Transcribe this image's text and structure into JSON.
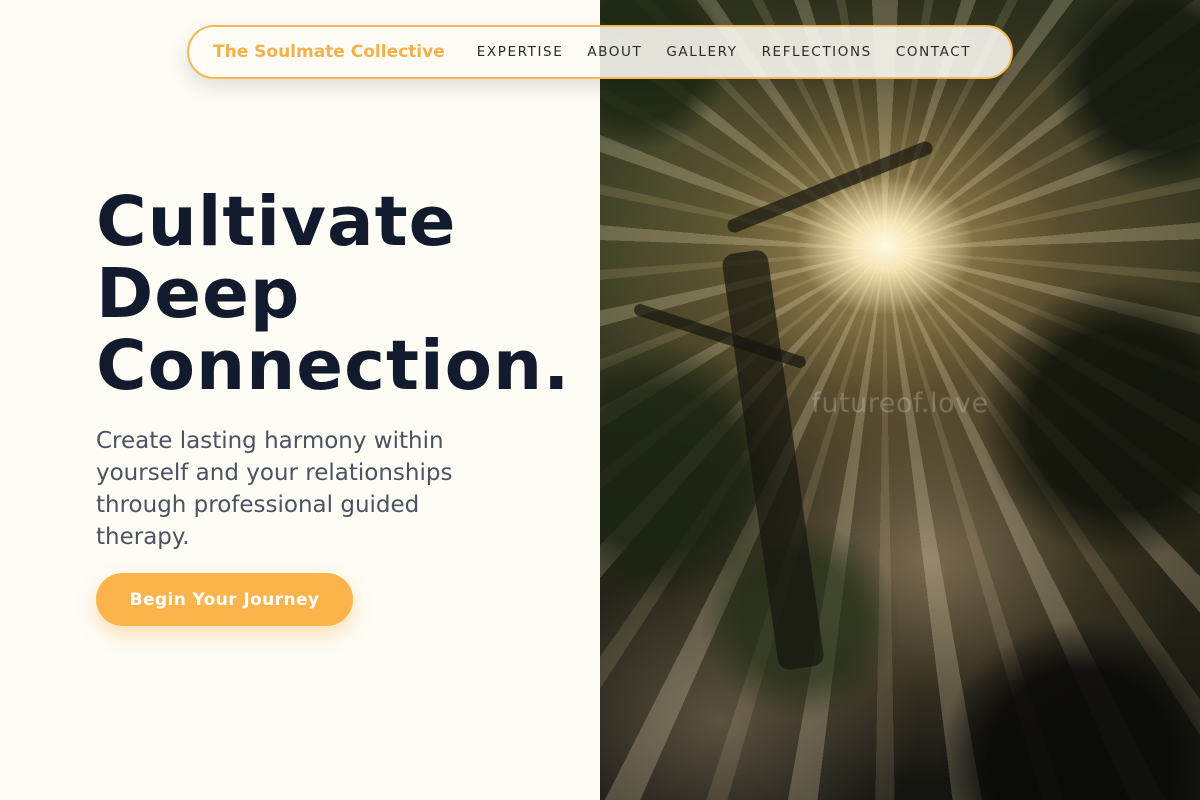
{
  "nav": {
    "brand": "The Soulmate Collective",
    "links": [
      "EXPERTISE",
      "ABOUT",
      "GALLERY",
      "REFLECTIONS",
      "CONTACT"
    ]
  },
  "hero": {
    "title_lines": [
      "Cultivate",
      "Deep",
      "Connection."
    ],
    "subtitle": "Create lasting harmony within yourself and your relationships through professional guided therapy.",
    "cta_label": "Begin Your Journey"
  },
  "image": {
    "watermark": "futureof.love"
  },
  "colors": {
    "accent": "#f7b851",
    "button": "#fbb44c",
    "title": "#121a2e",
    "subtitle": "#4b5362",
    "background": "#fdfcf5"
  }
}
